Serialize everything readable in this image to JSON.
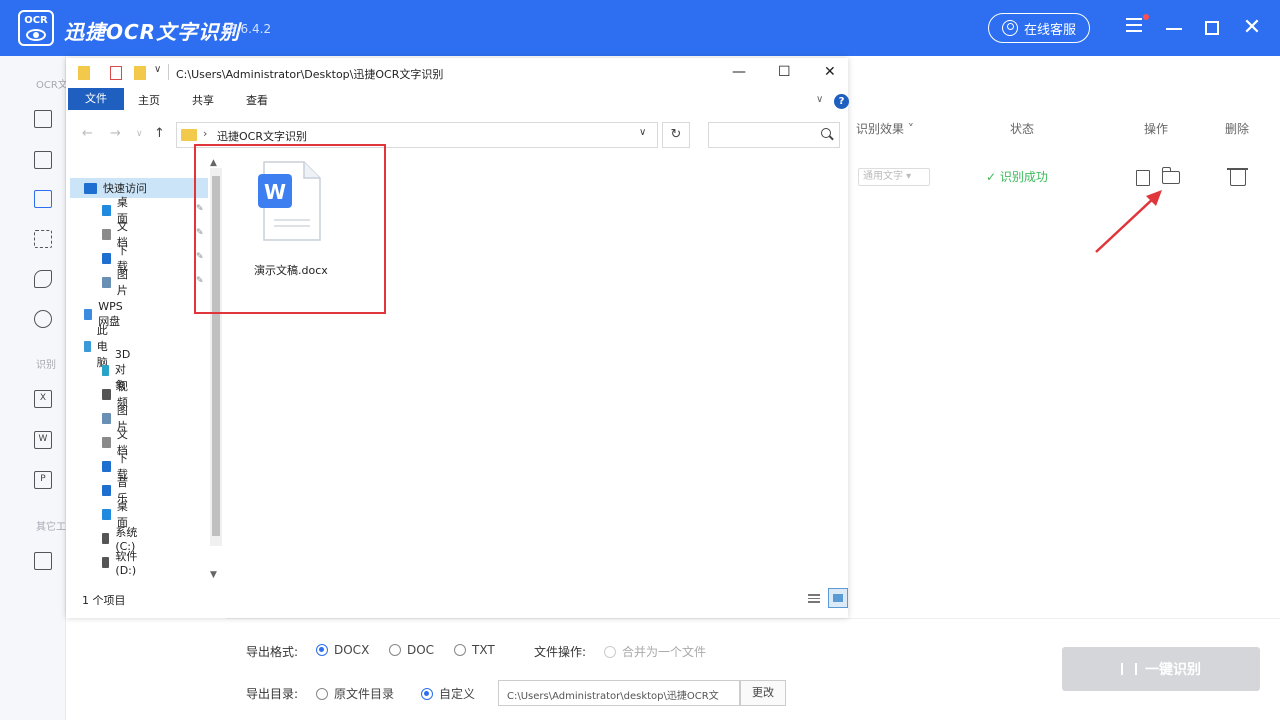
{
  "app": {
    "title": "迅捷OCR文字识别",
    "version": "v8.6.4.2",
    "support_label": "在线客服",
    "logo_text": "OCR"
  },
  "sidebar": {
    "sections": [
      "OCR文",
      "识别",
      "其它工"
    ],
    "icons": [
      {
        "name": "image-ocr-icon"
      },
      {
        "name": "batch-icon"
      },
      {
        "name": "pdf-image-icon"
      },
      {
        "name": "crop-icon"
      },
      {
        "name": "handwriting-icon"
      },
      {
        "name": "translate-icon"
      },
      {
        "name": "excel-icon",
        "glyph": "X"
      },
      {
        "name": "word-icon",
        "glyph": "W"
      },
      {
        "name": "ppt-icon",
        "glyph": "P"
      },
      {
        "name": "table-icon"
      }
    ]
  },
  "table": {
    "headers": {
      "effect": "识别效果",
      "status": "状态",
      "action": "操作",
      "delete": "删除"
    },
    "row": {
      "effect_value": "通用文字",
      "status": "✓ 识别成功"
    }
  },
  "export": {
    "format_label": "导出格式:",
    "formats": [
      "DOCX",
      "DOC",
      "TXT"
    ],
    "selected_format": "DOCX",
    "file_op_label": "文件操作:",
    "merge_option": "合并为一个文件",
    "dir_label": "导出目录:",
    "dir_options": [
      "原文件目录",
      "自定义"
    ],
    "selected_dir": "自定义",
    "path": "C:\\Users\\Administrator\\desktop\\迅捷OCR文",
    "change_label": "更改",
    "recognize_label": "一键识别"
  },
  "explorer": {
    "title_path": "C:\\Users\\Administrator\\Desktop\\迅捷OCR文字识别",
    "ribbon_tabs": [
      "文件",
      "主页",
      "共享",
      "查看"
    ],
    "address": "迅捷OCR文字识别",
    "search_placeholder": "",
    "nav_items": [
      {
        "label": "快速访问",
        "icon": "quick-access-icon",
        "color": "#1f6fd1",
        "level": 0,
        "selected": true
      },
      {
        "label": "桌面",
        "icon": "desktop-icon",
        "color": "#1f8ae0",
        "level": 1,
        "pinned": true
      },
      {
        "label": "文档",
        "icon": "documents-icon",
        "color": "#8a8a8a",
        "level": 1,
        "pinned": true
      },
      {
        "label": "下载",
        "icon": "download-icon",
        "color": "#1f6fd1",
        "level": 1,
        "pinned": true
      },
      {
        "label": "图片",
        "icon": "pictures-icon",
        "color": "#6a8fb5",
        "level": 1,
        "pinned": true
      },
      {
        "label": "WPS网盘",
        "icon": "wps-cloud-icon",
        "color": "#3d8be0",
        "level": 0
      },
      {
        "label": "此电脑",
        "icon": "this-pc-icon",
        "color": "#3a9ad9",
        "level": 0
      },
      {
        "label": "3D 对象",
        "icon": "3d-objects-icon",
        "color": "#29a3c8",
        "level": 1
      },
      {
        "label": "视频",
        "icon": "videos-icon",
        "color": "#555555",
        "level": 1
      },
      {
        "label": "图片",
        "icon": "pictures-icon",
        "color": "#6a8fb5",
        "level": 1
      },
      {
        "label": "文档",
        "icon": "documents-icon",
        "color": "#8a8a8a",
        "level": 1
      },
      {
        "label": "下载",
        "icon": "download-icon",
        "color": "#1f6fd1",
        "level": 1
      },
      {
        "label": "音乐",
        "icon": "music-icon",
        "color": "#1f6fd1",
        "level": 1
      },
      {
        "label": "桌面",
        "icon": "desktop-icon",
        "color": "#1f8ae0",
        "level": 1
      },
      {
        "label": "系统 (C:)",
        "icon": "drive-c-icon",
        "color": "#555555",
        "level": 1
      },
      {
        "label": "软件 (D:)",
        "icon": "drive-d-icon",
        "color": "#555555",
        "level": 1
      }
    ],
    "item_count": "1 个项目",
    "file": {
      "name": "演示文稿.docx",
      "icon": "word-doc-icon",
      "badge": "W"
    }
  },
  "colors": {
    "brand": "#2d6ff0",
    "success": "#3dbb5a",
    "highlight": "#e0353b"
  }
}
